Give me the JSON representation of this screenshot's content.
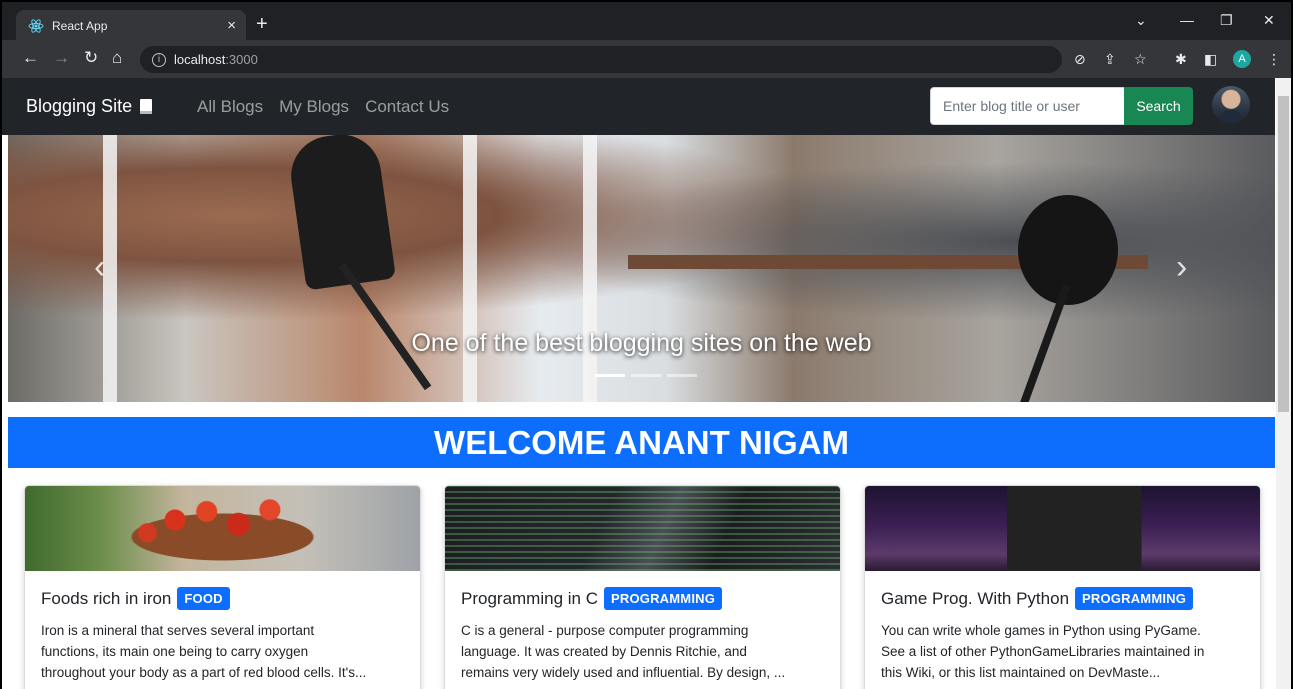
{
  "browser": {
    "tab_title": "React App",
    "tab_close": "×",
    "new_tab": "+",
    "url_host": "localhost",
    "url_port": ":3000",
    "profile_initial": "A"
  },
  "navbar": {
    "brand": "Blogging Site",
    "links": [
      "All Blogs",
      "My Blogs",
      "Contact Us"
    ],
    "search_placeholder": "Enter blog title or user",
    "search_button": "Search"
  },
  "carousel": {
    "caption": "One of the best blogging sites on the web",
    "slide_count": 3,
    "active_slide": 0
  },
  "welcome": {
    "text": "WELCOME ANANT NIGAM"
  },
  "cards": [
    {
      "title": "Foods rich in iron",
      "badge": "FOOD",
      "lines": [
        "Iron is a mineral that serves several important",
        "functions, its main one being to carry oxygen",
        "throughout your body as a part of red blood cells. It's..."
      ]
    },
    {
      "title": "Programming in C",
      "badge": "PROGRAMMING",
      "lines": [
        "C is a general - purpose computer programming",
        "language. It was created by Dennis Ritchie, and",
        "remains very widely used and influential. By design, ..."
      ]
    },
    {
      "title": "Game Prog. With Python",
      "badge": "PROGRAMMING",
      "lines": [
        "You can write whole games in Python using PyGame.",
        "See a list of other PythonGameLibraries maintained in",
        "this Wiki, or this list maintained on DevMaste..."
      ]
    }
  ],
  "colors": {
    "navbar_bg": "#212529",
    "primary": "#0d6efd",
    "search_button": "#198754"
  }
}
